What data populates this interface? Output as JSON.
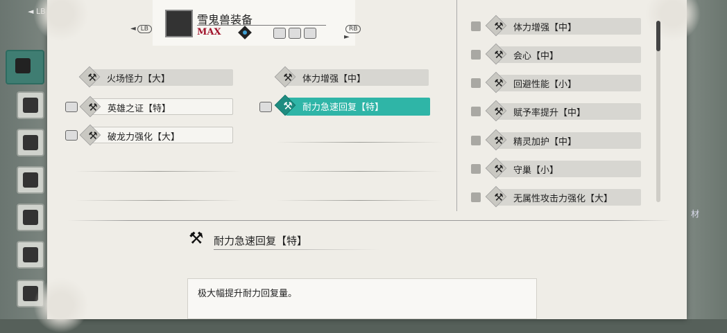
{
  "equipment": {
    "name": "雪鬼兽装备",
    "level": "MAX",
    "nav_prev": "LB",
    "nav_next": "RB"
  },
  "side_tab_hint": "LB",
  "slotted_skills": [
    {
      "label": "火场怪力【大】",
      "deco": false
    },
    {
      "label": "英雄之证【特】",
      "deco": true
    },
    {
      "label": "破龙力强化【大】",
      "deco": true
    },
    {
      "label": "体力增强【中】",
      "deco": false
    },
    {
      "label": "耐力急速回复【特】",
      "deco": true,
      "selected": true
    }
  ],
  "skill_list": [
    {
      "label": "体力增强【中】"
    },
    {
      "label": "会心【中】"
    },
    {
      "label": "回避性能【小】"
    },
    {
      "label": "赋予率提升【中】"
    },
    {
      "label": "精灵加护【中】"
    },
    {
      "label": "守巢【小】"
    },
    {
      "label": "无属性攻击力强化【大】"
    }
  ],
  "detail": {
    "title": "耐力急速回复【特】",
    "description": "极大幅提升耐力回复量。"
  },
  "right_side_label": "材",
  "colors": {
    "accent": "#2fb5a7",
    "max_red": "#a0132b"
  }
}
